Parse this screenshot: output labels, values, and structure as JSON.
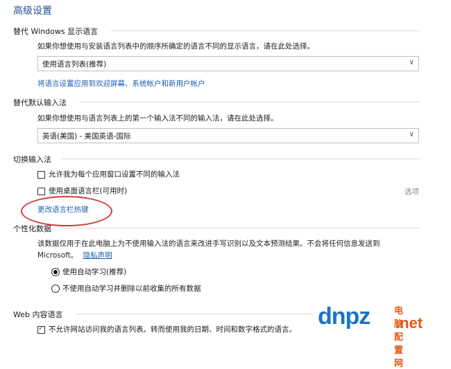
{
  "page": {
    "title": "高级设置"
  },
  "display_language": {
    "heading": "替代 Windows 显示语言",
    "description": "如果你想使用与安装语言列表中的顺序所确定的语言不同的显示语言，请在此处选择。",
    "select_value": "使用语言列表(推荐)",
    "apply_link": "将语言设置应用到欢迎屏幕、系统帐户和新用户帐户"
  },
  "input_method": {
    "heading": "替代默认输入法",
    "description": "如果你想使用与语言列表上的第一个输入法不同的输入法，请在此处选择。",
    "select_value": "英语(美国) - 美国英语-国际"
  },
  "switch_input": {
    "heading": "切换输入法",
    "checkbox_per_app": {
      "label": "允许我为每个应用窗口设置不同的输入法",
      "checked": false
    },
    "checkbox_langbar": {
      "label": "使用桌面语言栏(可用时)",
      "checked": false
    },
    "options_link": "选项",
    "hotkey_link": "更改语言栏热键"
  },
  "personalization": {
    "heading": "个性化数据",
    "description_line1": "该数据仅用于在此电脑上为不使用输入法的语言来改进手写识别以及文本预测结果。不会将任何信息发送到",
    "description_line2": "Microsoft。",
    "privacy_link": "隐私声明",
    "radio_auto": {
      "label": "使用自动学习(推荐)",
      "checked": true
    },
    "radio_no_auto": {
      "label": "不使用自动学习并删除以前收集的所有数据",
      "checked": false
    }
  },
  "web_content": {
    "heading": "Web 内容语言",
    "checkbox_block": {
      "label": "不允许网站访问我的语言列表。转而使用我的日期、时间和数字格式的语言。",
      "checked": true
    }
  },
  "watermark": {
    "logo": "dnpz",
    "cn": "电脑配置网",
    "net": ".net"
  },
  "colors": {
    "accent": "#1a5fb4",
    "title": "#1f4e99",
    "highlight": "#d9383a"
  }
}
